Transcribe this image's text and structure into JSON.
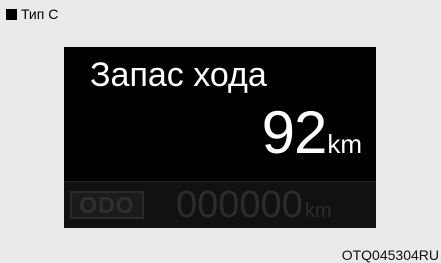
{
  "type_label": "Тип C",
  "display": {
    "range_title": "Запас хода",
    "range_value": "92",
    "range_unit": "km",
    "odo_label": "ODO",
    "odo_value": "000000",
    "odo_unit": "km"
  },
  "figure_code": "OTQ045304RU",
  "colors": {
    "background": "#eaeaeb",
    "screen": "#000000",
    "active_text": "#ffffff",
    "inactive_text": "#2c2c2c"
  },
  "icons": {
    "type_marker": "black-square-icon"
  }
}
